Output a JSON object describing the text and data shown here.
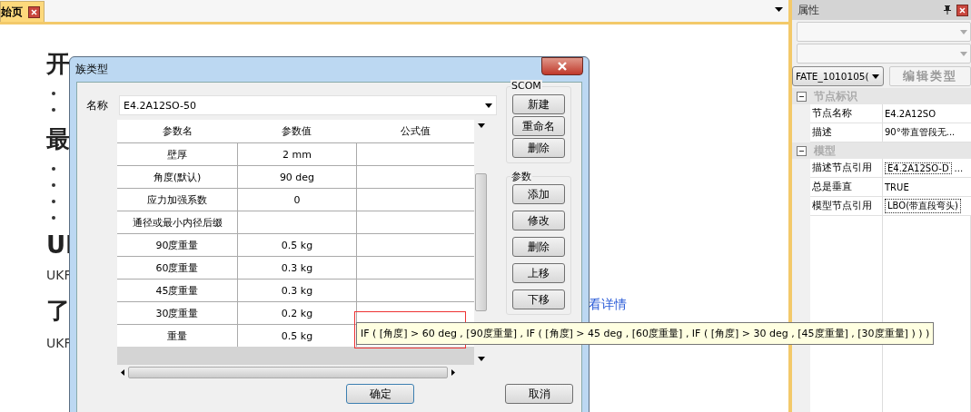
{
  "tab_bar": {
    "tabs": [
      {
        "label": "始页",
        "selected": true
      }
    ]
  },
  "background_page": {
    "blocks": [
      {
        "kind": "heading",
        "text": "开"
      },
      {
        "kind": "bullet"
      },
      {
        "kind": "bullet"
      },
      {
        "kind": "heading",
        "text": "最"
      },
      {
        "kind": "bullet"
      },
      {
        "kind": "bullet"
      },
      {
        "kind": "bullet"
      },
      {
        "kind": "bullet"
      },
      {
        "kind": "heading",
        "text": "UI"
      },
      {
        "kind": "paragraph",
        "text": "UKF"
      },
      {
        "kind": "heading",
        "text": "了"
      },
      {
        "kind": "paragraph",
        "text": "UKF"
      }
    ],
    "link": "看详情"
  },
  "dialog": {
    "title": "族类型",
    "name_label": "名称",
    "name_value": "E4.2A12SO-50",
    "table": {
      "columns": [
        "参数名",
        "参数值",
        "公式值"
      ],
      "rows": [
        [
          "壁厚",
          "2 mm",
          ""
        ],
        [
          "角度(默认)",
          "90 deg",
          ""
        ],
        [
          "应力加强系数",
          "0",
          ""
        ],
        [
          "通径或最小内径后缀",
          "",
          ""
        ],
        [
          "90度重量",
          "0.5 kg",
          ""
        ],
        [
          "60度重量",
          "0.3 kg",
          ""
        ],
        [
          "45度重量",
          "0.3 kg",
          ""
        ],
        [
          "30度重量",
          "0.2 kg",
          ""
        ],
        [
          "重量",
          "0.5 kg",
          ""
        ]
      ]
    },
    "groups": [
      {
        "title": "SCOM",
        "buttons": [
          "新建",
          "重命名",
          "删除"
        ]
      },
      {
        "title": "参数",
        "buttons": [
          "添加",
          "修改",
          "删除",
          "上移",
          "下移"
        ]
      }
    ],
    "ok": "确定",
    "cancel": "取消"
  },
  "tooltip": "IF ( [角度] > 60 deg , [90度重量] , IF ( [角度] > 45 deg , [60度重量] , IF ( [角度] > 30 deg , [45度重量] , [30度重量] ) ) )",
  "properties": {
    "title": "属性",
    "type_combo": "FATE_1010105(",
    "edit_type": {
      "label": "编辑类型",
      "disabled": true
    },
    "sections": [
      {
        "label": "节点标识",
        "expanded": true,
        "children": [
          {
            "name": "节点名称",
            "value": "E4.2A12SO",
            "boxed": false
          },
          {
            "name": "描述",
            "value": "90°带直管段无...",
            "boxed": false
          }
        ]
      },
      {
        "label": "模型",
        "expanded": true,
        "children": [
          {
            "name": "描述节点引用",
            "value": "E4.2A12SO-D",
            "boxed": true,
            "browse": "..."
          },
          {
            "name": "总是垂直",
            "value": "TRUE",
            "boxed": false
          },
          {
            "name": "模型节点引用",
            "value": "LBO(带直段弯头)",
            "boxed": true
          }
        ]
      }
    ]
  }
}
